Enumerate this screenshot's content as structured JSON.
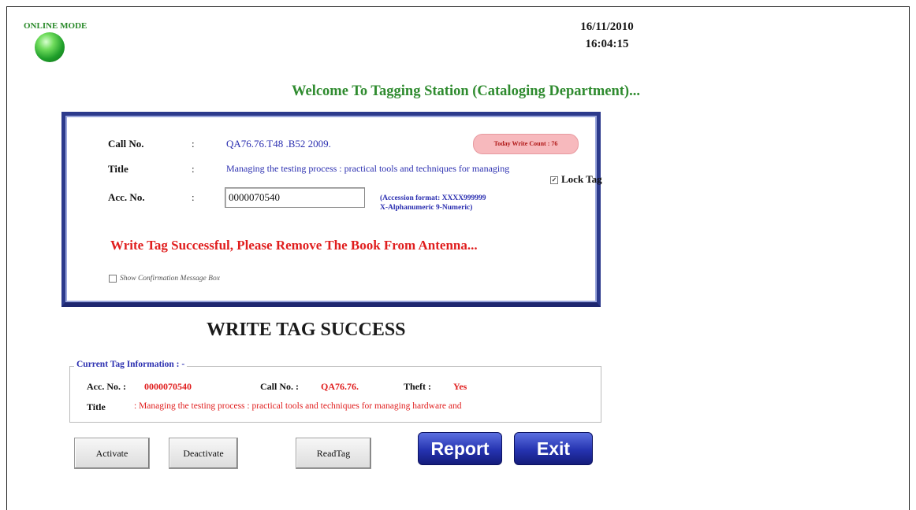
{
  "status": {
    "mode_label": "ONLINE MODE"
  },
  "datetime": {
    "date": "16/11/2010",
    "time": "16:04:15"
  },
  "welcome": "Welcome To Tagging Station (Cataloging Department)...",
  "form": {
    "callno_label": "Call No.",
    "title_label": "Title",
    "accno_label": "Acc. No.",
    "colon": ":",
    "callno_value": "QA76.76.T48 .B52 2009.",
    "title_value": "Managing the testing process : practical tools and techniques for managing",
    "accno_value": "0000070540",
    "write_count": "Today Write Count : 76",
    "lock_tag_label": "Lock Tag",
    "lock_tag_checked": true,
    "format_line1": "(Accession format: XXXX999999",
    "format_line2": "X-Alphanumeric 9-Numeric)",
    "message": "Write Tag Successful, Please Remove The Book From Antenna...",
    "confirm_label": "Show Confirmation Message Box",
    "confirm_checked": false
  },
  "result_heading": "WRITE TAG SUCCESS",
  "tag_info": {
    "legend": "Current Tag Information : -",
    "acc_label": "Acc. No. :",
    "acc_value": "0000070540",
    "call_label": "Call No. :",
    "call_value": "QA76.76.",
    "theft_label": "Theft :",
    "theft_value": "Yes",
    "title_label": "Title",
    "title_value": ": Managing the testing process : practical tools and techniques for managing hardware and"
  },
  "buttons": {
    "activate": "Activate",
    "deactivate": "Deactivate",
    "readtag": "ReadTag",
    "report": "Report",
    "exit": "Exit"
  },
  "colors": {
    "accent_green": "#2f8b2f",
    "alert_red": "#e01e1e",
    "link_blue": "#2b2fb0",
    "panel_border": "#2c3a8c"
  }
}
